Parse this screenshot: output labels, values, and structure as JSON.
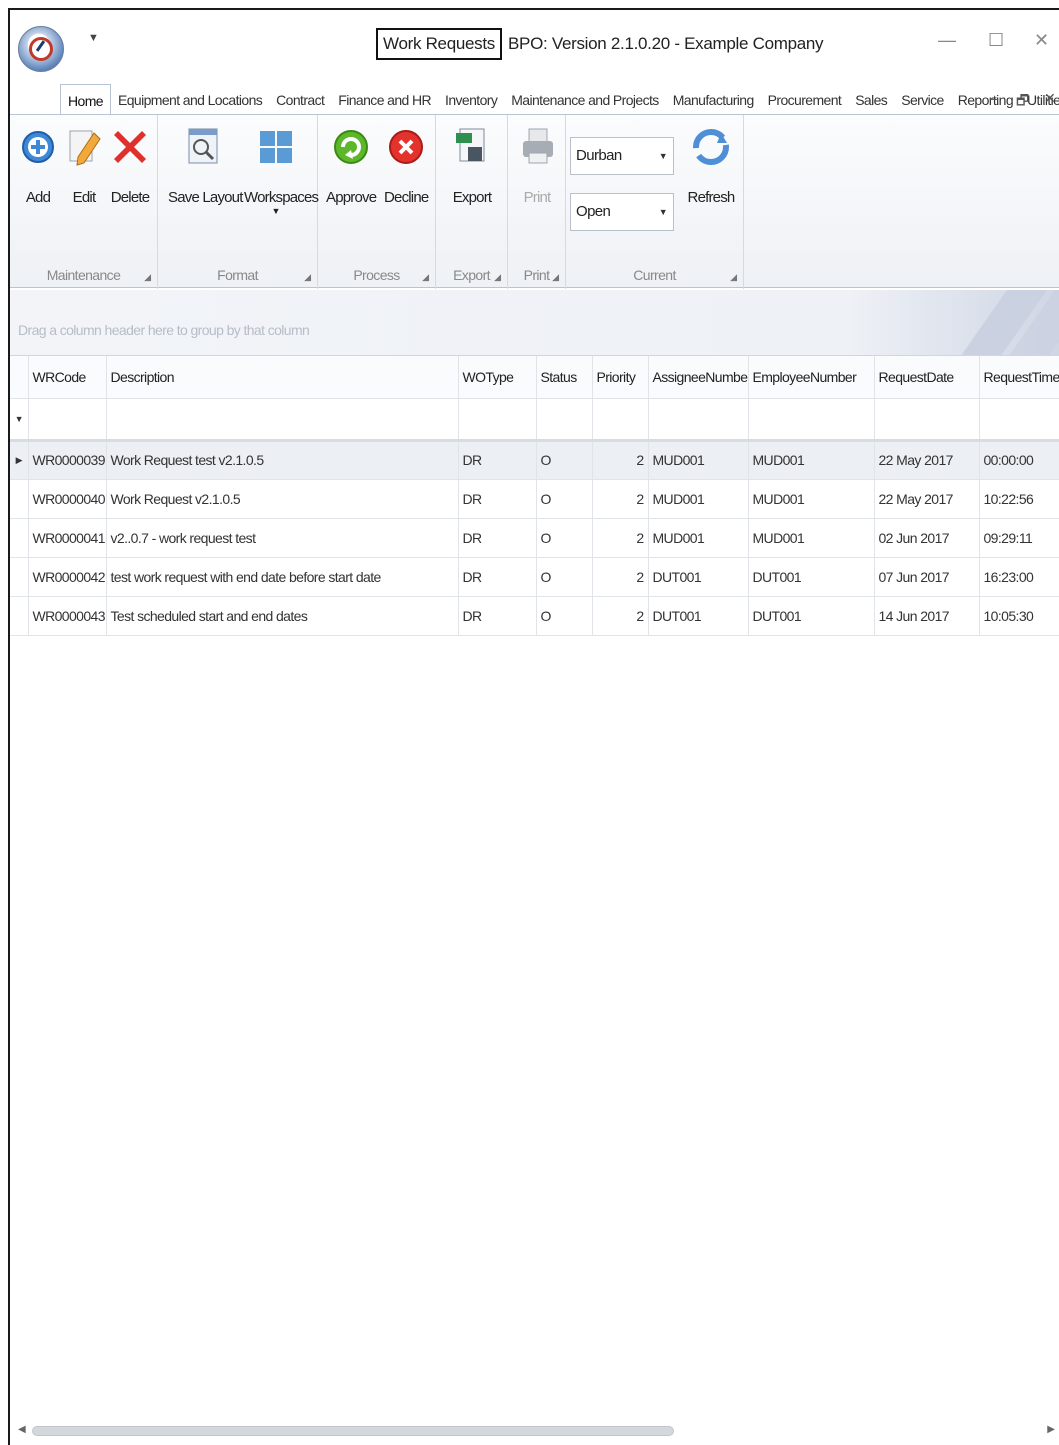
{
  "window": {
    "title_boxed": "Work Requests",
    "title_rest": "BPO: Version 2.1.0.20 - Example Company"
  },
  "tabs": [
    "Home",
    "Equipment and Locations",
    "Contract",
    "Finance and HR",
    "Inventory",
    "Maintenance and Projects",
    "Manufacturing",
    "Procurement",
    "Sales",
    "Service",
    "Reporting",
    "Utilities"
  ],
  "ribbon": {
    "maintenance": {
      "label": "Maintenance",
      "add": "Add",
      "edit": "Edit",
      "delete": "Delete"
    },
    "format": {
      "label": "Format",
      "save_layout": "Save Layout",
      "workspaces": "Workspaces"
    },
    "process": {
      "label": "Process",
      "approve": "Approve",
      "decline": "Decline"
    },
    "export": {
      "label": "Export",
      "export": "Export"
    },
    "print": {
      "label": "Print",
      "print": "Print"
    },
    "current": {
      "label": "Current",
      "site": "Durban",
      "status": "Open",
      "refresh": "Refresh"
    }
  },
  "group_panel_hint": "Drag a column header here to group by that column",
  "grid": {
    "columns": [
      "WRCode",
      "Description",
      "WOType",
      "Status",
      "Priority",
      "AssigneeNumber",
      "EmployeeNumber",
      "RequestDate",
      "RequestTime"
    ],
    "rows": [
      [
        "WR0000039",
        "Work Request test v2.1.0.5",
        "DR",
        "O",
        "2",
        "MUD001",
        "MUD001",
        "22 May 2017",
        "00:00:00"
      ],
      [
        "WR0000040",
        "Work Request v2.1.0.5",
        "DR",
        "O",
        "2",
        "MUD001",
        "MUD001",
        "22 May 2017",
        "10:22:56"
      ],
      [
        "WR0000041",
        "v2..0.7 - work request test",
        "DR",
        "O",
        "2",
        "MUD001",
        "MUD001",
        "02 Jun 2017",
        "09:29:11"
      ],
      [
        "WR0000042",
        "test work request with end date before start date",
        "DR",
        "O",
        "2",
        "DUT001",
        "DUT001",
        "07 Jun 2017",
        "16:23:00"
      ],
      [
        "WR0000043",
        "Test scheduled start and end dates",
        "DR",
        "O",
        "2",
        "DUT001",
        "DUT001",
        "14 Jun 2017",
        "10:05:30"
      ]
    ],
    "selected_row": 0
  }
}
